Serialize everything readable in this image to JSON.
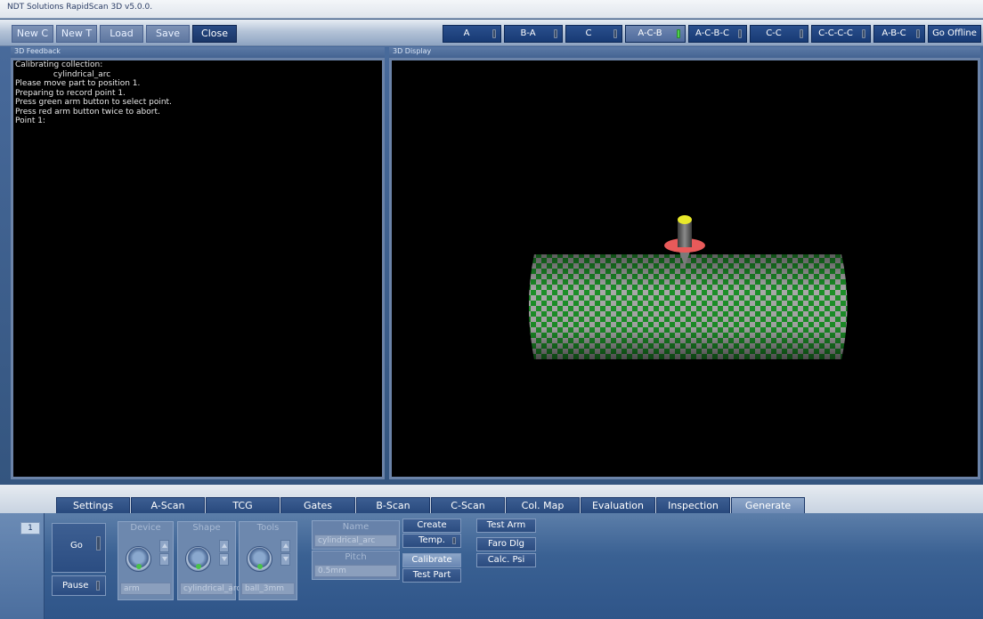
{
  "app": {
    "title": "NDT Solutions RapidScan 3D v5.0.0."
  },
  "toolbar": {
    "new_c": "New C",
    "new_t": "New T",
    "load": "Load",
    "save": "Save",
    "close": "Close",
    "views": [
      {
        "label": "A",
        "selected": false
      },
      {
        "label": "B-A",
        "selected": false
      },
      {
        "label": "C",
        "selected": false
      },
      {
        "label": "A-C-B",
        "selected": true
      },
      {
        "label": "A-C-B-C",
        "selected": false
      },
      {
        "label": "C-C",
        "selected": false
      },
      {
        "label": "C-C-C-C",
        "selected": false
      },
      {
        "label": "A-B-C",
        "selected": false
      }
    ],
    "go_offline": "Go Offline"
  },
  "feedback": {
    "title": "3D Feedback",
    "lines": [
      "Calibrating collection:",
      "               cylindrical_arc",
      "Please move part to position 1.",
      "Preparing to record point 1.",
      "Press green arm button to select point.",
      "Press red arm button twice to abort.",
      "Point 1:"
    ]
  },
  "display": {
    "title": "3D Display"
  },
  "tabs": [
    {
      "label": "Settings",
      "selected": false
    },
    {
      "label": "A-Scan",
      "selected": false
    },
    {
      "label": "TCG",
      "selected": false
    },
    {
      "label": "Gates",
      "selected": false
    },
    {
      "label": "B-Scan",
      "selected": false
    },
    {
      "label": "C-Scan",
      "selected": false
    },
    {
      "label": "Col. Map",
      "selected": false
    },
    {
      "label": "Evaluation",
      "selected": false
    },
    {
      "label": "Inspection",
      "selected": false
    },
    {
      "label": "Generate",
      "selected": true
    }
  ],
  "bottom": {
    "page": "1",
    "go": "Go",
    "pause": "Pause",
    "device": {
      "title": "Device",
      "value": "arm"
    },
    "shape": {
      "title": "Shape",
      "value": "cylindrical_arc"
    },
    "tools": {
      "title": "Tools",
      "value": "ball_3mm"
    },
    "name": {
      "title": "Name",
      "value": "cylindrical_arc"
    },
    "pitch": {
      "title": "Pitch",
      "value": "0.5mm"
    },
    "create": "Create",
    "temp": "Temp.",
    "calibrate": "Calibrate",
    "test_part": "Test Part",
    "test_arm": "Test Arm",
    "faro_dlg": "Faro Dlg",
    "calc_psi": "Calc. Psi"
  },
  "colors": {
    "accent": "#2a4f8d",
    "checker_green": "#1f9a2b",
    "checker_gray": "#9a9a9a",
    "probe_red": "#e85a5a",
    "probe_tip": "#e8e82a"
  }
}
